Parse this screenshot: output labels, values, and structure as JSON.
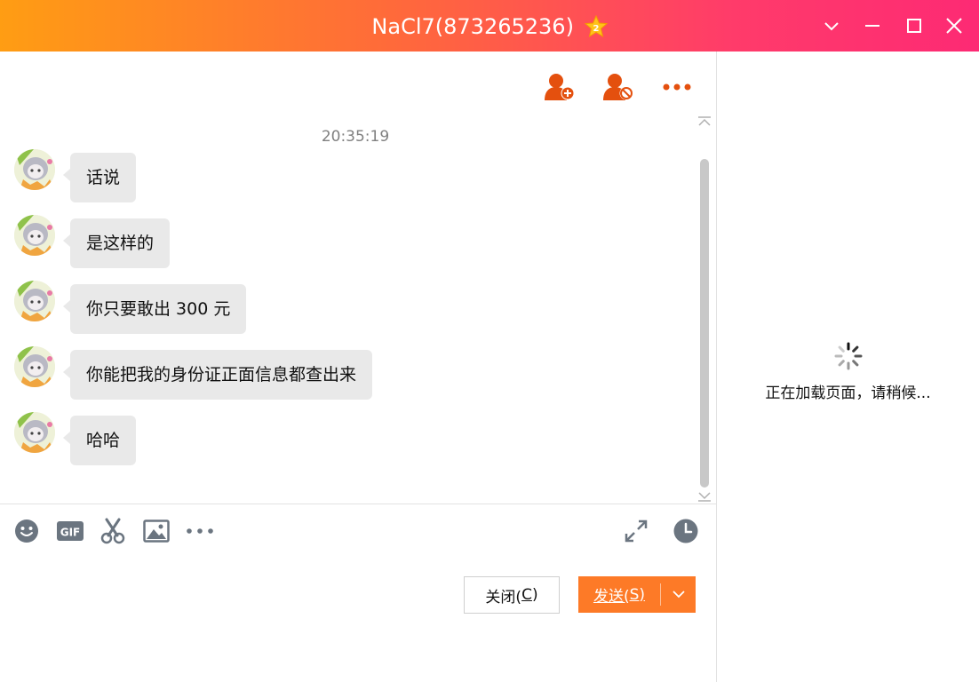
{
  "window": {
    "title": "NaCl7(873265236)",
    "vip_level": "2",
    "colors": {
      "gradient_start": "#ff9d13",
      "gradient_end": "#fd2a74"
    },
    "controls": [
      "chevron-down-icon",
      "minimize-icon",
      "maximize-icon",
      "close-icon"
    ]
  },
  "chat": {
    "header_actions": [
      "add-friend-icon",
      "block-user-icon",
      "more-icon"
    ],
    "timestamp": "20:35:19",
    "messages": [
      {
        "text": "话说"
      },
      {
        "text": "是这样的"
      },
      {
        "text": "你只要敢出 300 元"
      },
      {
        "text": "你能把我的身份证正面信息都查出来"
      },
      {
        "text": "哈哈"
      }
    ],
    "bubble_color": "#e9e9e9"
  },
  "toolbar": {
    "tools": [
      "emoji-icon",
      "gif-icon",
      "scissors-icon",
      "image-icon",
      "more-icon"
    ],
    "right_tools": [
      "expand-icon",
      "history-clock-icon"
    ]
  },
  "buttons": {
    "close_label": "关闭(",
    "close_key": "C",
    "close_suffix": ")",
    "send_label": "发送(",
    "send_key": "S",
    "send_suffix": ")",
    "send_color": "#fd7a27"
  },
  "side_panel": {
    "loading_text": "正在加载页面，请稍候..."
  }
}
